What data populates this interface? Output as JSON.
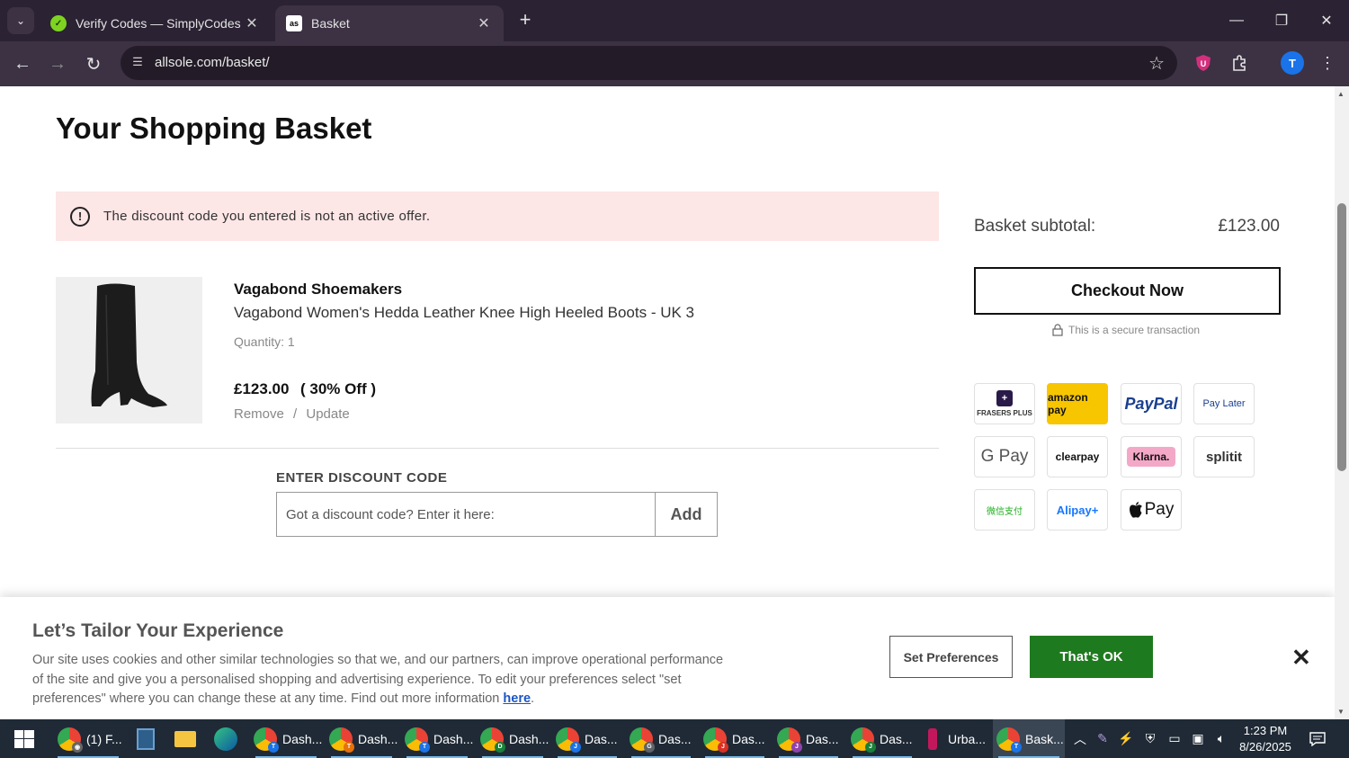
{
  "browser": {
    "tabs": [
      {
        "title": "Verify Codes — SimplyCodes",
        "active": false
      },
      {
        "title": "Basket",
        "active": true
      }
    ],
    "url": "allsole.com/basket/",
    "profile_initial": "T"
  },
  "page": {
    "title": "Your Shopping Basket",
    "alert": "The discount code you entered is not an active offer.",
    "item": {
      "brand": "Vagabond Shoemakers",
      "name": "Vagabond Women's Hedda Leather Knee High Heeled Boots - UK 3",
      "quantity": "Quantity: 1",
      "price": "£123.00",
      "discount": "( 30% Off )",
      "remove": "Remove",
      "separator": "/",
      "update": "Update"
    },
    "discount": {
      "label": "ENTER DISCOUNT CODE",
      "placeholder": "Got a discount code? Enter it here:",
      "button": "Add"
    },
    "summary": {
      "subtotal_label": "Basket subtotal:",
      "subtotal_value": "£123.00",
      "checkout": "Checkout Now",
      "secure": "This is a secure transaction"
    },
    "payment_methods": [
      "FRASERS PLUS",
      "amazon pay",
      "PayPal",
      "Pay Later",
      "G Pay",
      "clearpay",
      "Klarna.",
      "splitit",
      "微信支付",
      "Alipay+",
      "Pay"
    ]
  },
  "cookie": {
    "title": "Let’s Tailor Your Experience",
    "text": "Our site uses cookies and other similar technologies so that we, and our partners, can improve operational performance of the site and give you a personalised shopping and advertising experience. To edit your preferences select \"set preferences\" where you can change these at any time. Find out more information ",
    "link": "here",
    "set_preferences": "Set Preferences",
    "ok": "That's OK"
  },
  "taskbar": {
    "items": [
      "(1) F...",
      "Dash...",
      "Dash...",
      "Dash...",
      "Dash...",
      "Das...",
      "Das...",
      "Das...",
      "Das...",
      "Das...",
      "Urba...",
      "Bask..."
    ],
    "time": "1:23 PM",
    "date": "8/26/2025"
  }
}
